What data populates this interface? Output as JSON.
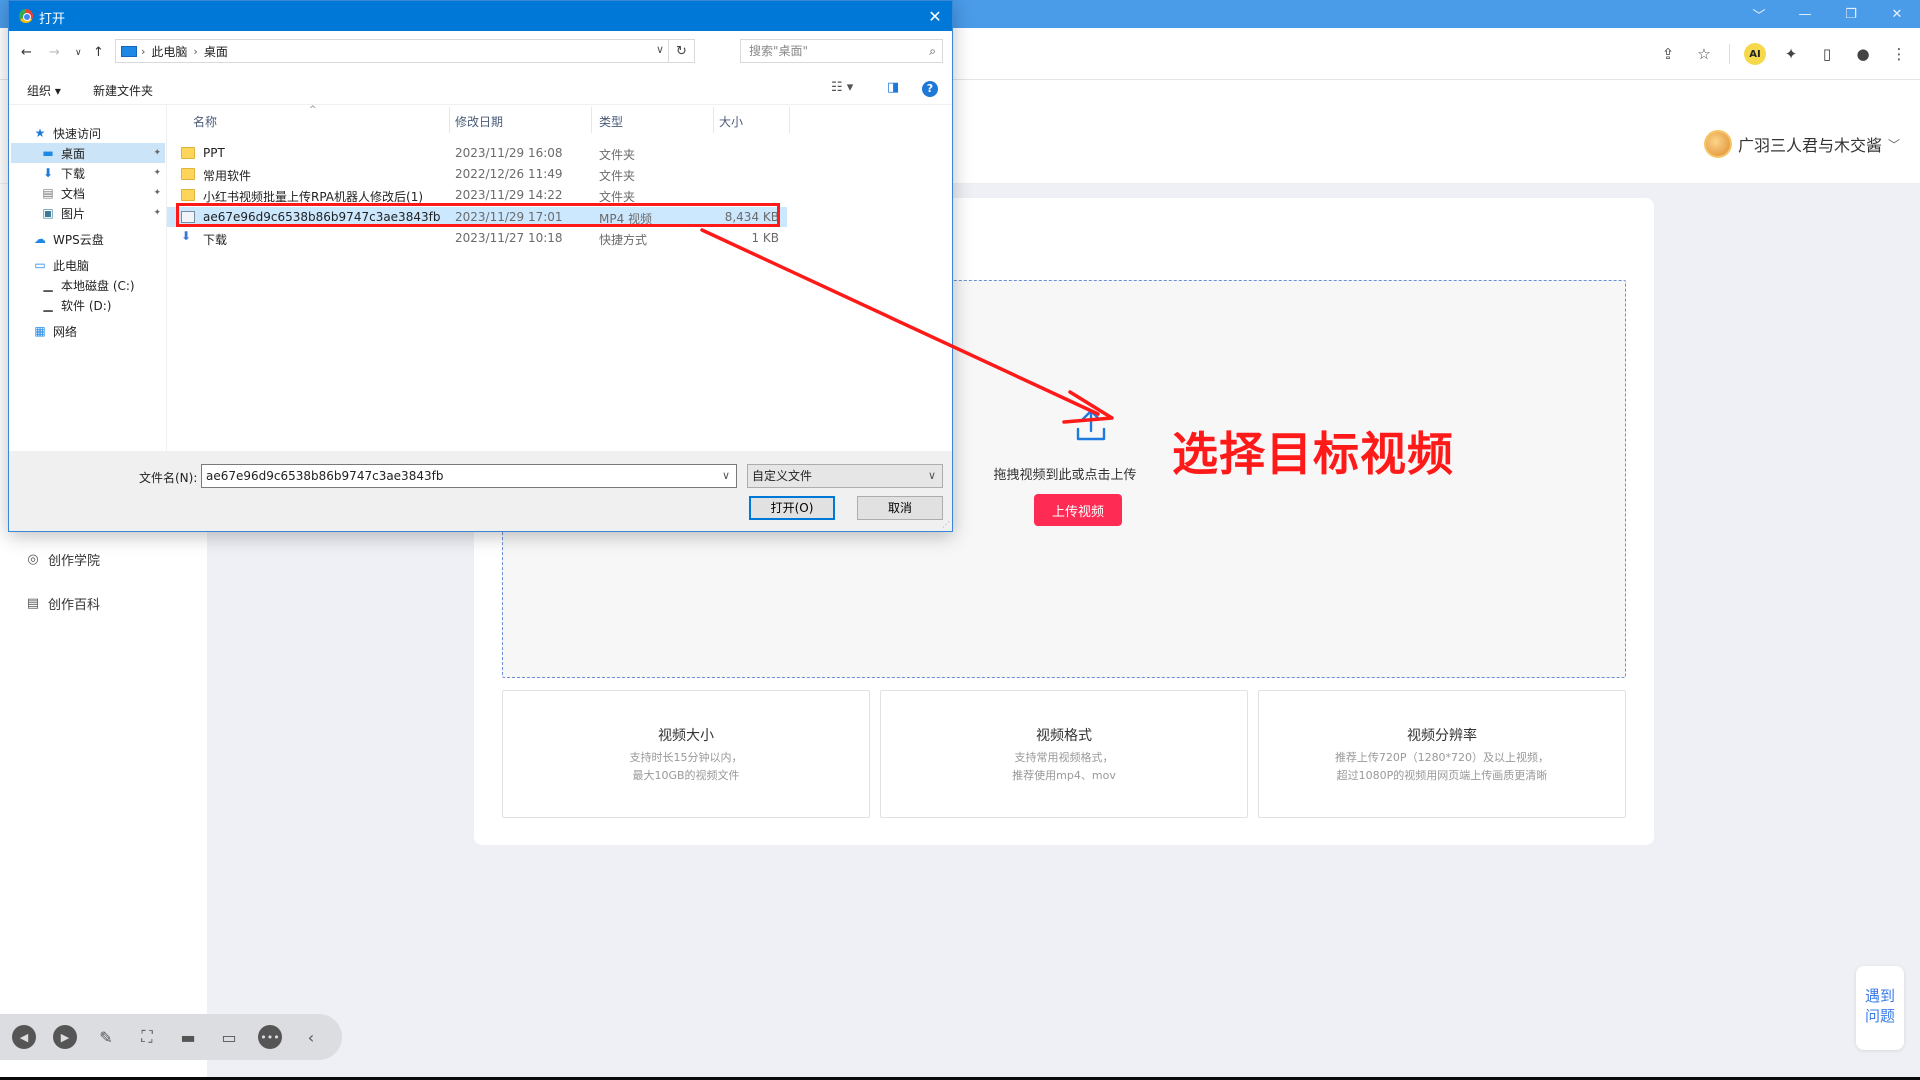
{
  "browser": {
    "win_controls": [
      "﹀",
      "—",
      "❐",
      "✕"
    ],
    "toolbar_icons": [
      "share-icon",
      "star-icon",
      "ai-extension-icon",
      "puzzle-icon",
      "sidebar-icon",
      "profile-icon",
      "menu-icon"
    ],
    "ai_badge": "AI"
  },
  "header": {
    "username": "广羽三人君与木交酱"
  },
  "sidebar": {
    "items": [
      {
        "label": "创作学院",
        "icon": "academy-icon"
      },
      {
        "label": "创作百科",
        "icon": "wiki-icon"
      }
    ]
  },
  "upload": {
    "hint": "拖拽视频到此或点击上传",
    "button": "上传视频",
    "specs": [
      {
        "title": "视频大小",
        "lines": [
          "支持时长15分钟以内，",
          "最大10GB的视频文件"
        ]
      },
      {
        "title": "视频格式",
        "lines": [
          "支持常用视频格式，",
          "推荐使用mp4、mov"
        ]
      },
      {
        "title": "视频分辨率",
        "lines": [
          "推荐上传720P（1280*720）及以上视频，",
          "超过1080P的视频用网页端上传画质更清晰"
        ]
      }
    ]
  },
  "annotation": {
    "text": "选择目标视频",
    "color": "#ff1a1a"
  },
  "help_widget": {
    "line1": "遇到",
    "line2": "问题"
  },
  "dialog": {
    "title": "打开",
    "breadcrumb": [
      "此电脑",
      "桌面"
    ],
    "search_placeholder": "搜索\"桌面\"",
    "organize": "组织 ▾",
    "new_folder": "新建文件夹",
    "nav": {
      "quick_access": "快速访问",
      "desktop": "桌面",
      "downloads": "下载",
      "documents": "文档",
      "pictures": "图片",
      "wps": "WPS云盘",
      "this_pc": "此电脑",
      "disk_c": "本地磁盘 (C:)",
      "disk_d": "软件 (D:)",
      "network": "网络"
    },
    "columns": {
      "name": "名称",
      "date": "修改日期",
      "type": "类型",
      "size": "大小"
    },
    "files": [
      {
        "name": "PPT",
        "date": "2023/11/29 16:08",
        "type": "文件夹",
        "size": "",
        "kind": "folder"
      },
      {
        "name": "常用软件",
        "date": "2022/12/26 11:49",
        "type": "文件夹",
        "size": "",
        "kind": "folder"
      },
      {
        "name": "小红书视频批量上传RPA机器人修改后(1)",
        "date": "2023/11/29 14:22",
        "type": "文件夹",
        "size": "",
        "kind": "folder"
      },
      {
        "name": "ae67e96d9c6538b86b9747c3ae3843fb",
        "date": "2023/11/29 17:01",
        "type": "MP4 视频",
        "size": "8,434 KB",
        "kind": "video"
      },
      {
        "name": "下载",
        "date": "2023/11/27 10:18",
        "type": "快捷方式",
        "size": "1 KB",
        "kind": "shortcut"
      }
    ],
    "filename_label": "文件名(N):",
    "filename_value": "ae67e96d9c6538b86b9747c3ae3843fb",
    "filetype": "自定义文件",
    "open_button": "打开(O)",
    "cancel_button": "取消"
  }
}
